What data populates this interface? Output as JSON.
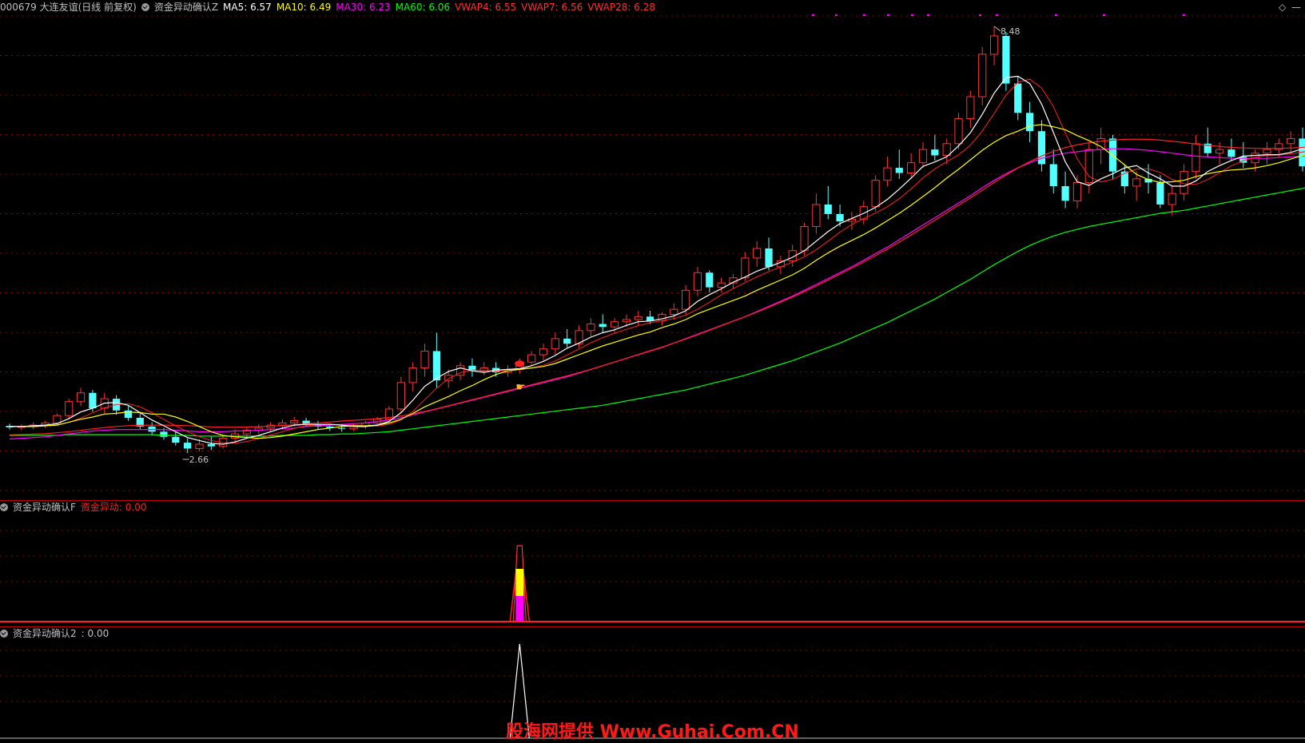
{
  "main_header": {
    "stock": "000679 大连友谊(日线 前复权)",
    "indicator": "资金异动确认Z",
    "ma5": "MA5: 6.57",
    "ma10": "MA10: 6.49",
    "ma30": "MA30: 6.23",
    "ma60": "MA60: 6.06",
    "vwap4": "VWAP4: 6.55",
    "vwap7": "VWAP7: 6.56",
    "vwap28": "VWAP28: 6.28"
  },
  "window_buttons": {
    "diamond": "◇",
    "minimize": "—"
  },
  "price_annotations": {
    "high": "8.48",
    "low": "2.66"
  },
  "sub1_header": {
    "name": "资金异动确认F",
    "value": "资金异动: 0.00"
  },
  "sub2_header": {
    "name": "资金异动确认2",
    "value": ": 0.00"
  },
  "watermark": "股海网提供 Www.Guhai.Com.CN",
  "colors": {
    "up": "#ff3232",
    "down": "#54ffff",
    "ma5": "#ffffff",
    "ma10": "#ffff00",
    "ma30": "#ff00ff",
    "ma60": "#00ff00",
    "vwap": "#ff2020",
    "grid": "#8b0000",
    "signal_yellow": "#ffff00",
    "signal_magenta": "#ff00ff"
  },
  "chart_data": {
    "type": "candlestick",
    "price_range": [
      2.3,
      8.6
    ],
    "high": 8.48,
    "low": 2.66,
    "signal_bar_index": 43,
    "ohlc": [
      [
        3.03,
        3.06,
        2.98,
        3.01
      ],
      [
        3.01,
        3.05,
        2.97,
        3.02
      ],
      [
        3.02,
        3.08,
        2.98,
        3.04
      ],
      [
        3.04,
        3.1,
        3.0,
        3.07
      ],
      [
        3.07,
        3.2,
        3.03,
        3.17
      ],
      [
        3.17,
        3.4,
        3.12,
        3.36
      ],
      [
        3.36,
        3.55,
        3.3,
        3.48
      ],
      [
        3.48,
        3.52,
        3.22,
        3.27
      ],
      [
        3.27,
        3.48,
        3.2,
        3.4
      ],
      [
        3.4,
        3.45,
        3.18,
        3.24
      ],
      [
        3.24,
        3.3,
        3.1,
        3.14
      ],
      [
        3.14,
        3.2,
        2.98,
        3.02
      ],
      [
        3.02,
        3.08,
        2.9,
        2.95
      ],
      [
        2.95,
        3.0,
        2.84,
        2.88
      ],
      [
        2.88,
        2.95,
        2.76,
        2.8
      ],
      [
        2.8,
        2.86,
        2.66,
        2.72
      ],
      [
        2.72,
        2.85,
        2.68,
        2.78
      ],
      [
        2.78,
        2.88,
        2.7,
        2.75
      ],
      [
        2.75,
        2.9,
        2.72,
        2.86
      ],
      [
        2.86,
        2.98,
        2.8,
        2.92
      ],
      [
        2.92,
        3.02,
        2.86,
        2.97
      ],
      [
        2.97,
        3.05,
        2.92,
        3.0
      ],
      [
        3.0,
        3.08,
        2.95,
        3.04
      ],
      [
        3.04,
        3.12,
        2.98,
        3.07
      ],
      [
        3.07,
        3.15,
        3.02,
        3.1
      ],
      [
        3.1,
        3.14,
        3.02,
        3.05
      ],
      [
        3.05,
        3.1,
        2.98,
        3.02
      ],
      [
        3.02,
        3.06,
        2.96,
        3.0
      ],
      [
        3.0,
        3.05,
        2.95,
        2.99
      ],
      [
        2.99,
        3.06,
        2.96,
        3.03
      ],
      [
        3.03,
        3.1,
        2.99,
        3.07
      ],
      [
        3.07,
        3.15,
        3.02,
        3.12
      ],
      [
        3.12,
        3.3,
        3.08,
        3.26
      ],
      [
        3.26,
        3.7,
        3.2,
        3.62
      ],
      [
        3.62,
        3.9,
        3.5,
        3.82
      ],
      [
        3.82,
        4.15,
        3.7,
        4.05
      ],
      [
        4.05,
        4.3,
        3.55,
        3.65
      ],
      [
        3.65,
        3.8,
        3.55,
        3.72
      ],
      [
        3.72,
        3.9,
        3.65,
        3.85
      ],
      [
        3.85,
        3.95,
        3.7,
        3.78
      ],
      [
        3.78,
        3.9,
        3.72,
        3.82
      ],
      [
        3.82,
        3.9,
        3.7,
        3.76
      ],
      [
        3.76,
        3.86,
        3.7,
        3.8
      ],
      [
        3.8,
        3.95,
        3.74,
        3.9
      ],
      [
        3.9,
        4.05,
        3.85,
        4.0
      ],
      [
        4.0,
        4.15,
        3.92,
        4.08
      ],
      [
        4.08,
        4.3,
        4.0,
        4.22
      ],
      [
        4.22,
        4.35,
        4.1,
        4.15
      ],
      [
        4.15,
        4.4,
        4.1,
        4.33
      ],
      [
        4.33,
        4.5,
        4.25,
        4.42
      ],
      [
        4.42,
        4.55,
        4.3,
        4.38
      ],
      [
        4.38,
        4.5,
        4.3,
        4.45
      ],
      [
        4.45,
        4.55,
        4.38,
        4.48
      ],
      [
        4.48,
        4.6,
        4.4,
        4.52
      ],
      [
        4.52,
        4.6,
        4.42,
        4.46
      ],
      [
        4.46,
        4.58,
        4.4,
        4.55
      ],
      [
        4.55,
        4.7,
        4.48,
        4.62
      ],
      [
        4.62,
        4.95,
        4.55,
        4.88
      ],
      [
        4.88,
        5.2,
        4.8,
        5.12
      ],
      [
        5.12,
        5.15,
        4.85,
        4.92
      ],
      [
        4.92,
        5.05,
        4.85,
        4.98
      ],
      [
        4.98,
        5.1,
        4.9,
        5.05
      ],
      [
        5.05,
        5.4,
        5.0,
        5.32
      ],
      [
        5.32,
        5.55,
        5.2,
        5.45
      ],
      [
        5.45,
        5.6,
        5.15,
        5.2
      ],
      [
        5.2,
        5.35,
        5.1,
        5.28
      ],
      [
        5.28,
        5.5,
        5.2,
        5.42
      ],
      [
        5.42,
        5.8,
        5.35,
        5.75
      ],
      [
        5.75,
        6.2,
        5.65,
        6.05
      ],
      [
        6.05,
        6.3,
        5.85,
        5.92
      ],
      [
        5.92,
        6.05,
        5.75,
        5.82
      ],
      [
        5.82,
        5.95,
        5.7,
        5.85
      ],
      [
        5.85,
        6.1,
        5.78,
        6.02
      ],
      [
        6.02,
        6.45,
        5.95,
        6.38
      ],
      [
        6.38,
        6.7,
        6.3,
        6.55
      ],
      [
        6.55,
        6.8,
        6.4,
        6.48
      ],
      [
        6.48,
        6.75,
        6.4,
        6.62
      ],
      [
        6.62,
        6.9,
        6.55,
        6.8
      ],
      [
        6.8,
        7.0,
        6.65,
        6.72
      ],
      [
        6.72,
        6.95,
        6.6,
        6.88
      ],
      [
        6.88,
        7.3,
        6.8,
        7.22
      ],
      [
        7.22,
        7.6,
        7.1,
        7.52
      ],
      [
        7.52,
        8.2,
        7.4,
        8.1
      ],
      [
        8.1,
        8.48,
        7.95,
        8.35
      ],
      [
        8.35,
        8.4,
        7.6,
        7.7
      ],
      [
        7.7,
        7.8,
        7.2,
        7.3
      ],
      [
        7.3,
        7.45,
        6.9,
        7.05
      ],
      [
        7.05,
        7.2,
        6.5,
        6.6
      ],
      [
        6.6,
        6.8,
        6.2,
        6.3
      ],
      [
        6.3,
        6.5,
        6.0,
        6.1
      ],
      [
        6.1,
        6.45,
        6.0,
        6.35
      ],
      [
        6.35,
        6.9,
        6.2,
        6.8
      ],
      [
        6.8,
        7.1,
        6.6,
        6.95
      ],
      [
        6.95,
        7.0,
        6.4,
        6.5
      ],
      [
        6.5,
        6.6,
        6.2,
        6.3
      ],
      [
        6.3,
        6.5,
        6.1,
        6.4
      ],
      [
        6.4,
        6.6,
        6.2,
        6.35
      ],
      [
        6.35,
        6.45,
        6.0,
        6.05
      ],
      [
        6.05,
        6.3,
        5.9,
        6.2
      ],
      [
        6.2,
        6.6,
        6.1,
        6.5
      ],
      [
        6.5,
        7.0,
        6.4,
        6.88
      ],
      [
        6.88,
        7.1,
        6.7,
        6.75
      ],
      [
        6.75,
        6.9,
        6.6,
        6.8
      ],
      [
        6.8,
        6.95,
        6.65,
        6.7
      ],
      [
        6.7,
        6.9,
        6.55,
        6.62
      ],
      [
        6.62,
        6.8,
        6.5,
        6.75
      ],
      [
        6.75,
        6.9,
        6.6,
        6.8
      ],
      [
        6.8,
        6.95,
        6.7,
        6.88
      ],
      [
        6.88,
        7.05,
        6.75,
        6.95
      ],
      [
        6.95,
        7.1,
        6.5,
        6.57
      ]
    ],
    "ma5": [
      3.02,
      3.02,
      3.03,
      3.04,
      3.06,
      3.13,
      3.22,
      3.27,
      3.34,
      3.35,
      3.31,
      3.21,
      3.11,
      3.03,
      2.95,
      2.87,
      2.83,
      2.79,
      2.78,
      2.81,
      2.86,
      2.9,
      2.95,
      3.0,
      3.04,
      3.05,
      3.05,
      3.05,
      3.04,
      3.02,
      3.02,
      3.04,
      3.09,
      3.21,
      3.38,
      3.57,
      3.68,
      3.77,
      3.82,
      3.78,
      3.76,
      3.79,
      3.8,
      3.81,
      3.85,
      3.91,
      3.99,
      4.09,
      4.16,
      4.24,
      4.3,
      4.34,
      4.4,
      4.45,
      4.46,
      4.49,
      4.53,
      4.6,
      4.73,
      4.82,
      4.9,
      4.99,
      5.06,
      5.14,
      5.2,
      5.26,
      5.33,
      5.42,
      5.55,
      5.68,
      5.79,
      5.86,
      5.93,
      6.01,
      6.12,
      6.26,
      6.41,
      6.57,
      6.63,
      6.7,
      6.85,
      7.03,
      7.28,
      7.57,
      7.78,
      7.8,
      7.7,
      7.42,
      7.03,
      6.63,
      6.36,
      6.31,
      6.4,
      6.47,
      6.55,
      6.58,
      6.48,
      6.4,
      6.3,
      6.3,
      6.37,
      6.5,
      6.58,
      6.65,
      6.71,
      6.72,
      6.73,
      6.73,
      6.76,
      6.81,
      6.79
    ],
    "ma10": [
      3.02,
      3.02,
      3.02,
      3.03,
      3.04,
      3.08,
      3.12,
      3.15,
      3.19,
      3.2,
      3.22,
      3.21,
      3.19,
      3.19,
      3.15,
      3.09,
      3.02,
      2.95,
      2.9,
      2.88,
      2.87,
      2.86,
      2.87,
      2.89,
      2.92,
      2.95,
      2.98,
      3.0,
      3.02,
      3.03,
      3.03,
      3.04,
      3.07,
      3.12,
      3.2,
      3.29,
      3.36,
      3.43,
      3.51,
      3.58,
      3.66,
      3.73,
      3.78,
      3.8,
      3.82,
      3.84,
      3.88,
      3.94,
      4.0,
      4.06,
      4.12,
      4.17,
      4.22,
      4.27,
      4.31,
      4.37,
      4.42,
      4.48,
      4.56,
      4.62,
      4.68,
      4.74,
      4.8,
      4.88,
      4.95,
      5.02,
      5.09,
      5.18,
      5.29,
      5.39,
      5.48,
      5.56,
      5.64,
      5.73,
      5.83,
      5.93,
      6.04,
      6.16,
      6.28,
      6.41,
      6.53,
      6.66,
      6.79,
      6.9,
      6.99,
      7.05,
      7.12,
      7.14,
      7.11,
      7.07,
      6.99,
      6.92,
      6.84,
      6.72,
      6.59,
      6.46,
      6.39,
      6.35,
      6.36,
      6.38,
      6.43,
      6.47,
      6.5,
      6.52,
      6.53,
      6.55,
      6.58,
      6.62,
      6.67,
      6.72,
      6.75
    ],
    "ma30": [
      2.85,
      2.86,
      2.87,
      2.88,
      2.9,
      2.92,
      2.94,
      2.96,
      2.97,
      2.98,
      2.98,
      2.98,
      2.98,
      2.98,
      2.97,
      2.96,
      2.95,
      2.95,
      2.95,
      2.96,
      2.96,
      2.97,
      2.98,
      2.99,
      3.0,
      3.02,
      3.03,
      3.04,
      3.05,
      3.06,
      3.07,
      3.09,
      3.11,
      3.14,
      3.18,
      3.22,
      3.26,
      3.3,
      3.34,
      3.38,
      3.42,
      3.46,
      3.5,
      3.54,
      3.58,
      3.62,
      3.66,
      3.7,
      3.75,
      3.8,
      3.85,
      3.9,
      3.95,
      4.0,
      4.05,
      4.1,
      4.16,
      4.22,
      4.28,
      4.34,
      4.4,
      4.46,
      4.52,
      4.59,
      4.66,
      4.73,
      4.8,
      4.88,
      4.96,
      5.04,
      5.12,
      5.2,
      5.29,
      5.38,
      5.47,
      5.57,
      5.67,
      5.77,
      5.87,
      5.97,
      6.07,
      6.17,
      6.28,
      6.38,
      6.47,
      6.55,
      6.62,
      6.68,
      6.72,
      6.75,
      6.77,
      6.79,
      6.8,
      6.81,
      6.81,
      6.8,
      6.79,
      6.77,
      6.75,
      6.73,
      6.71,
      6.7,
      6.69,
      6.68,
      6.68,
      6.68,
      6.68,
      6.69,
      6.7,
      6.71,
      6.72
    ],
    "ma60": [
      2.9,
      2.9,
      2.9,
      2.9,
      2.9,
      2.91,
      2.91,
      2.91,
      2.91,
      2.91,
      2.91,
      2.91,
      2.91,
      2.9,
      2.9,
      2.9,
      2.89,
      2.89,
      2.89,
      2.89,
      2.89,
      2.89,
      2.89,
      2.9,
      2.9,
      2.9,
      2.91,
      2.91,
      2.92,
      2.92,
      2.93,
      2.94,
      2.95,
      2.97,
      2.99,
      3.01,
      3.03,
      3.05,
      3.07,
      3.09,
      3.11,
      3.13,
      3.15,
      3.17,
      3.19,
      3.21,
      3.23,
      3.25,
      3.27,
      3.29,
      3.31,
      3.34,
      3.37,
      3.4,
      3.43,
      3.46,
      3.49,
      3.52,
      3.56,
      3.6,
      3.64,
      3.68,
      3.72,
      3.77,
      3.82,
      3.87,
      3.92,
      3.98,
      4.04,
      4.1,
      4.16,
      4.23,
      4.3,
      4.37,
      4.44,
      4.52,
      4.6,
      4.68,
      4.76,
      4.85,
      4.94,
      5.03,
      5.13,
      5.23,
      5.32,
      5.41,
      5.49,
      5.56,
      5.62,
      5.67,
      5.71,
      5.75,
      5.78,
      5.81,
      5.84,
      5.87,
      5.9,
      5.93,
      5.95,
      5.97,
      6.0,
      6.03,
      6.06,
      6.09,
      6.12,
      6.15,
      6.18,
      6.21,
      6.24,
      6.27,
      6.3
    ]
  }
}
